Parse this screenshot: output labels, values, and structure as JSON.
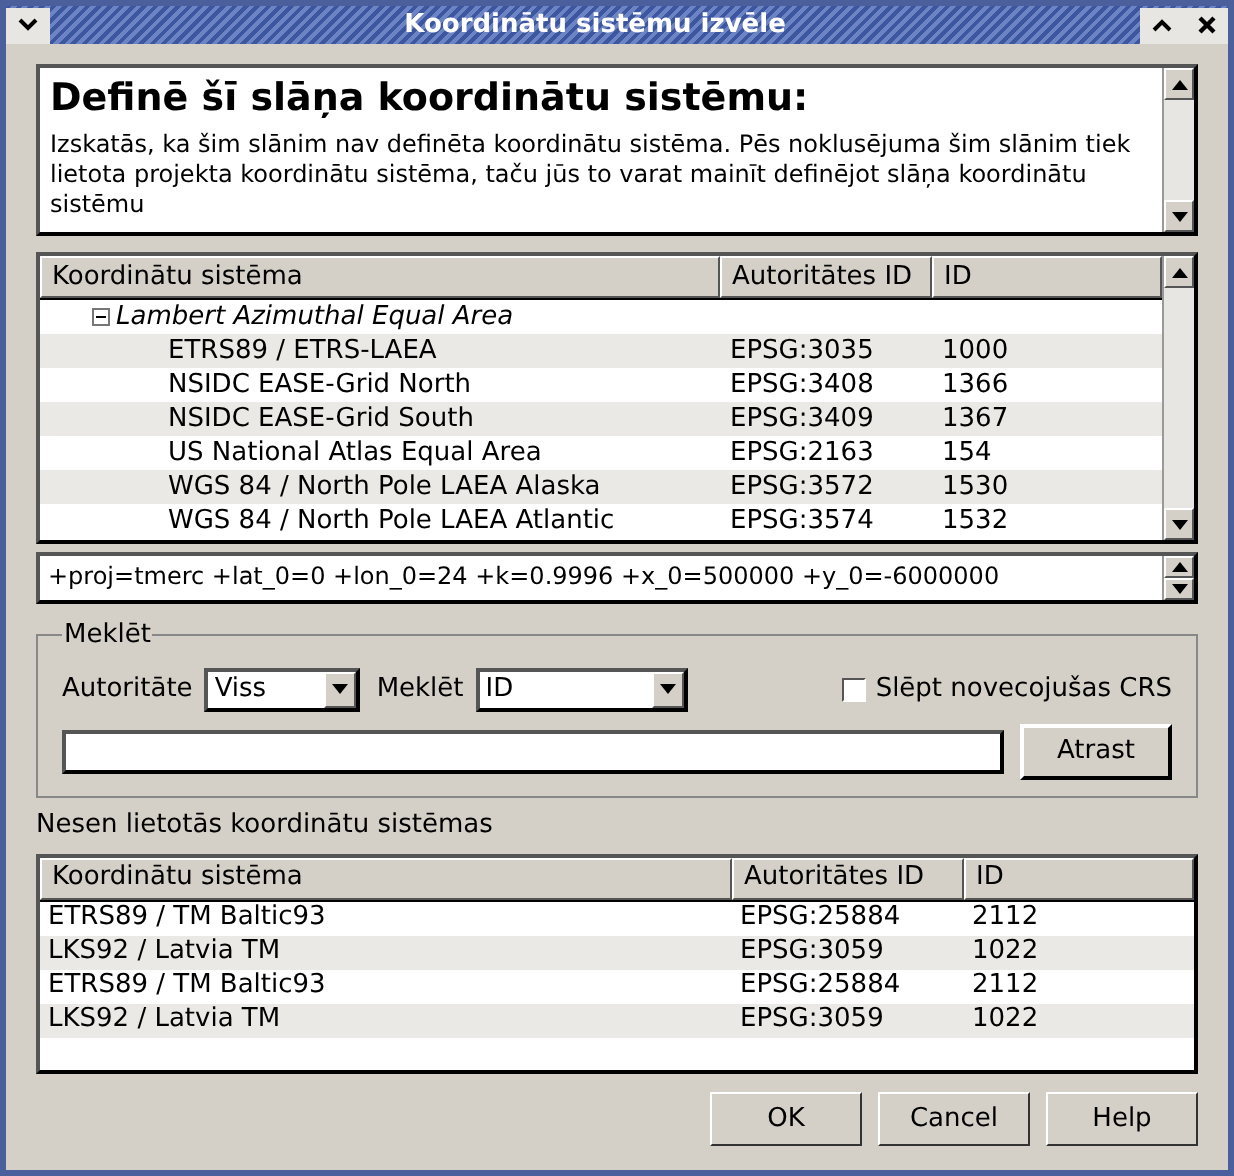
{
  "window": {
    "title": "Koordinātu sistēmu izvēle"
  },
  "description": {
    "heading": "Definē šī slāņa koordinātu sistēmu:",
    "text": "Izskatās, ka šim slānim nav definēta koordinātu sistēma. Pēs noklusējuma šim slānim tiek lietota projekta koordinātu sistēma, taču jūs to varat mainīt definējot slāņa koordinātu sistēmu"
  },
  "tree": {
    "columns": [
      "Koordinātu sistēma",
      "Autoritātes ID",
      "ID"
    ],
    "groups": [
      {
        "label": "Lambert Azimuthal Equal Area",
        "expanded": true,
        "children": [
          {
            "name": "ETRS89 / ETRS-LAEA",
            "authority_id": "EPSG:3035",
            "id": "1000"
          },
          {
            "name": "NSIDC EASE-Grid North",
            "authority_id": "EPSG:3408",
            "id": "1366"
          },
          {
            "name": "NSIDC EASE-Grid South",
            "authority_id": "EPSG:3409",
            "id": "1367"
          },
          {
            "name": "US National Atlas Equal Area",
            "authority_id": "EPSG:2163",
            "id": "154"
          },
          {
            "name": "WGS 84 / North Pole LAEA Alaska",
            "authority_id": "EPSG:3572",
            "id": "1530"
          },
          {
            "name": "WGS 84 / North Pole LAEA Atlantic",
            "authority_id": "EPSG:3574",
            "id": "1532"
          }
        ]
      }
    ]
  },
  "proj_string": "+proj=tmerc +lat_0=0 +lon_0=24 +k=0.9996 +x_0=500000 +y_0=-6000000",
  "search": {
    "title": "Meklēt",
    "authority_label": "Autoritāte",
    "authority_value": "Viss",
    "search_label": "Meklēt",
    "search_value": "ID",
    "hide_deprecated": {
      "label": "Slēpt novecojušas CRS",
      "checked": false
    },
    "button": "Atrast"
  },
  "recent": {
    "title": "Nesen lietotās koordinātu sistēmas",
    "columns": [
      "Koordinātu sistēma",
      "Autoritātes ID",
      "ID"
    ],
    "rows": [
      {
        "name": "ETRS89 / TM Baltic93",
        "authority_id": "EPSG:25884",
        "id": "2112"
      },
      {
        "name": "LKS92 / Latvia TM",
        "authority_id": "EPSG:3059",
        "id": "1022"
      },
      {
        "name": "ETRS89 / TM Baltic93",
        "authority_id": "EPSG:25884",
        "id": "2112"
      },
      {
        "name": "LKS92 / Latvia TM",
        "authority_id": "EPSG:3059",
        "id": "1022"
      }
    ]
  },
  "buttons": [
    "OK",
    "Cancel",
    "Help"
  ]
}
